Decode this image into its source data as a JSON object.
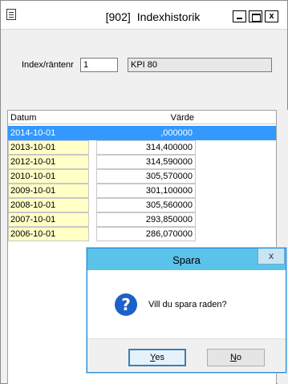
{
  "window": {
    "code": "[902]",
    "title": "Indexhistorik",
    "close_glyph": "x"
  },
  "form": {
    "index_label": "Index/räntenr",
    "index_value": "1",
    "index_name": "KPI 80"
  },
  "grid": {
    "columns": [
      "Datum",
      "Värde"
    ],
    "rows": [
      {
        "date": "2014-10-01",
        "value": ",000000",
        "selected": true
      },
      {
        "date": "2013-10-01",
        "value": "314,400000"
      },
      {
        "date": "2012-10-01",
        "value": "314,590000"
      },
      {
        "date": "2010-10-01",
        "value": "305,570000"
      },
      {
        "date": "2009-10-01",
        "value": "301,100000"
      },
      {
        "date": "2008-10-01",
        "value": "305,560000"
      },
      {
        "date": "2007-10-01",
        "value": "293,850000"
      },
      {
        "date": "2006-10-01",
        "value": "286,070000"
      }
    ]
  },
  "dialog": {
    "title": "Spara",
    "close_glyph": "x",
    "icon": "question-icon",
    "icon_glyph": "?",
    "message": "Vill du spara raden?",
    "yes_label_underlined": "Y",
    "yes_label_rest": "es",
    "no_label_underlined": "N",
    "no_label_rest": "o"
  },
  "colors": {
    "selection": "#3399ff",
    "date_cell": "#ffffc6",
    "dialog_title": "#5bc2ea",
    "question_icon": "#1b61c9"
  }
}
